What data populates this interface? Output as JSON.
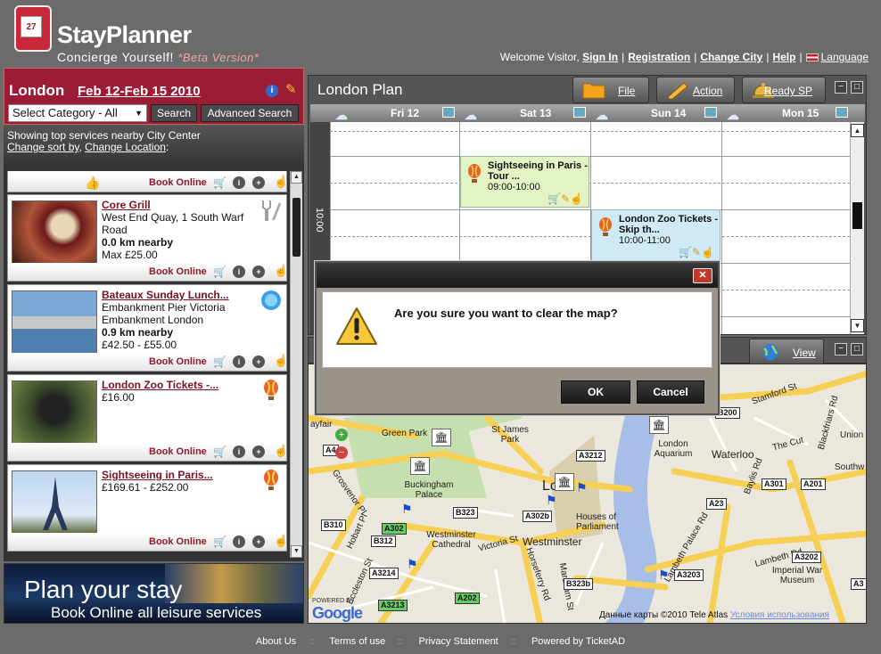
{
  "brand": {
    "name": "StayPlanner",
    "tagline": "Concierge Yourself!",
    "beta": "*Beta Version*",
    "cal_day": "27"
  },
  "topnav": {
    "welcome": "Welcome Visitor,",
    "sign_in": "Sign In",
    "registration": "Registration",
    "change_city": "Change City",
    "help": "Help",
    "language": "Language"
  },
  "city": {
    "name": "London",
    "dates": "Feb 12-Feb 15 2010"
  },
  "search": {
    "category": "Select Category - All",
    "search_label": "Search",
    "advanced_label": "Advanced Search"
  },
  "showing": {
    "text": "Showing top services nearby City Center",
    "change_sort": "Change sort by",
    "change_location": "Change Location"
  },
  "listing": {
    "book_label": "Book Online",
    "cards": [
      {
        "title": "Core Grill",
        "line1": "West End Quay, 1 South Warf",
        "line2": "Road",
        "dist": "0.0 km nearby",
        "price": "Max £25.00"
      },
      {
        "title": "Bateaux Sunday Lunch...",
        "line1": "Embankment Pier Victoria",
        "line2": "Embankment London",
        "dist": "0.9 km nearby",
        "price": "£42.50 - £55.00"
      },
      {
        "title": "London Zoo Tickets -...",
        "price": "£16.00"
      },
      {
        "title": "Sightseeing in Paris...",
        "price": "£169.61 - £252.00"
      }
    ]
  },
  "banner": {
    "line1": "Plan your stay",
    "line2": "Book Online all leisure services"
  },
  "plan": {
    "title": "London Plan",
    "file_label": "File",
    "action_label": "Action",
    "ready_label": "Ready SP",
    "days": [
      "Fri 12",
      "Sat 13",
      "Sun 14",
      "Mon 15"
    ],
    "time_label": "10:00",
    "events": [
      {
        "title": "Sightseeing in Paris - Tour ...",
        "time": "09:00-10:00"
      },
      {
        "title": "London Zoo Tickets - Skip th...",
        "time": "10:00-11:00"
      }
    ]
  },
  "map": {
    "view_label": "View",
    "labels": {
      "green_park": "Green Park",
      "st_james": "St James Park",
      "buckingham": "Buckingham Palace",
      "westminster_cathedral": "Westminster Cathedral",
      "westminster": "Westminster",
      "houses": "Houses of Parliament",
      "london_aquarium": "London Aquarium",
      "waterloo": "Waterloo",
      "the_cut": "The Cut",
      "union": "Union",
      "stamford": "Stamford St",
      "blackfriars": "Blackfriars Rd",
      "baylis": "Baylis Rd",
      "lambeth_palace": "Lambeth Palace Rd",
      "lambeth": "Lambeth Rd",
      "imperial": "Imperial War Museum",
      "victoria": "Victoria St",
      "horseferry": "Horseferry Rd",
      "marsham": "Marsham St",
      "grosvenor": "Grosvenor Pl",
      "hobart": "Hobart Pl",
      "eccleston": "Eccleston St",
      "mayfair": "ayfair",
      "south": "Southw",
      "lo": "Lo"
    },
    "roads": [
      "A4",
      "A302",
      "B323",
      "B310",
      "B312",
      "A3214",
      "A3212",
      "A301",
      "A201",
      "A23",
      "A3203",
      "A3202",
      "A302b",
      "A3213",
      "A202",
      "B200",
      "A3",
      "B323b"
    ],
    "copyright": "Данные карты ©2010 Tele Atlas",
    "terms": "Условия использования",
    "powered": "POWERED BY",
    "google": "Google"
  },
  "dialog": {
    "message": "Are you sure you want to clear the map?",
    "ok": "OK",
    "cancel": "Cancel"
  },
  "footer": {
    "about": "About Us",
    "terms": "Terms of use",
    "privacy": "Privacy Statement",
    "powered": "Powered by TicketAD"
  }
}
